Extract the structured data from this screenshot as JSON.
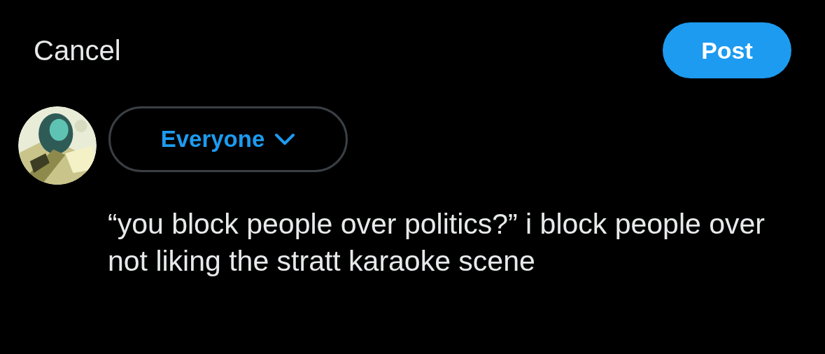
{
  "header": {
    "cancel": "Cancel",
    "post": "Post"
  },
  "composer": {
    "audience": "Everyone",
    "text": "“you block people over politics?” i block people over not liking the stratt karaoke scene"
  }
}
